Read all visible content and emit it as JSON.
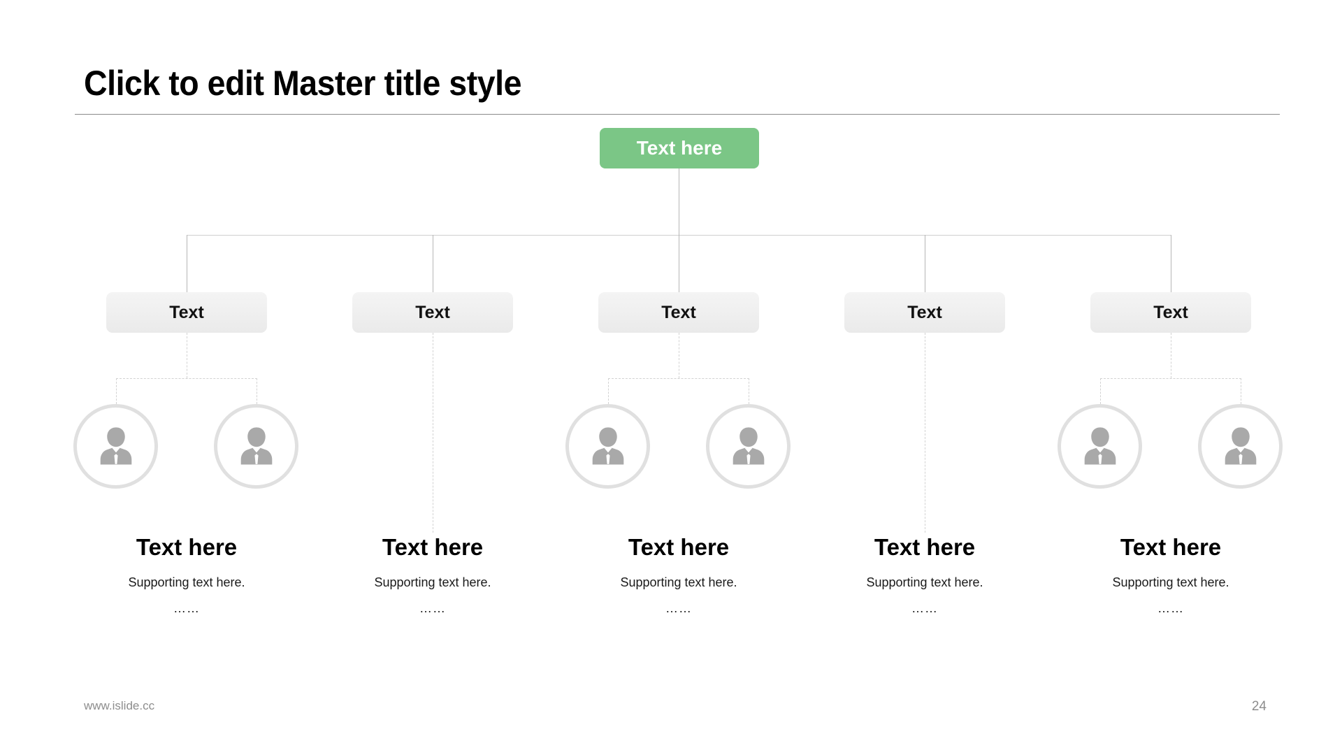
{
  "slide": {
    "title": "Click to edit Master title style",
    "accent_color": "#7bc686",
    "box_color": "#efefef",
    "line_color": "#d2d2d2",
    "icon_color": "#a9a9a9"
  },
  "root": {
    "label": "Text here"
  },
  "branches": [
    {
      "box_label": "Text",
      "heading": "Text here",
      "supporting": "Supporting text here.",
      "dots": "……",
      "icons": [
        "person-icon",
        "person-icon"
      ]
    },
    {
      "box_label": "Text",
      "heading": "Text here",
      "supporting": "Supporting text here.",
      "dots": "……",
      "icons": []
    },
    {
      "box_label": "Text",
      "heading": "Text here",
      "supporting": "Supporting text here.",
      "dots": "……",
      "icons": [
        "person-icon",
        "person-icon"
      ]
    },
    {
      "box_label": "Text",
      "heading": "Text here",
      "supporting": "Supporting text here.",
      "dots": "……",
      "icons": []
    },
    {
      "box_label": "Text",
      "heading": "Text here",
      "supporting": "Supporting text here.",
      "dots": "……",
      "icons": [
        "person-icon",
        "person-icon"
      ]
    }
  ],
  "footer": {
    "url": "www.islide.cc",
    "page_number": "24"
  }
}
